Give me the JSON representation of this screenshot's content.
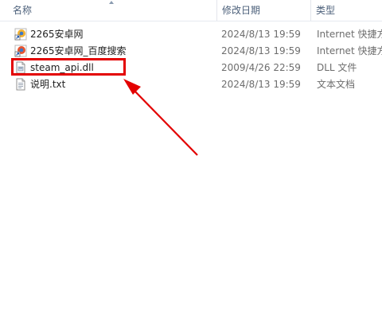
{
  "header": {
    "name_label": "名称",
    "date_label": "修改日期",
    "type_label": "类型"
  },
  "files": [
    {
      "name": "2265安卓网",
      "date": "2024/8/13 19:59",
      "type": "Internet 快捷方",
      "icon": "internet-shortcut-icon"
    },
    {
      "name": "2265安卓网_百度搜索",
      "date": "2024/8/13 19:59",
      "type": "Internet 快捷方",
      "icon": "internet-shortcut-icon"
    },
    {
      "name": "steam_api.dll",
      "date": "2009/4/26 22:59",
      "type": "DLL 文件",
      "icon": "dll-file-icon"
    },
    {
      "name": "说明.txt",
      "date": "2024/8/13 19:59",
      "type": "文本文档",
      "icon": "text-file-icon"
    }
  ],
  "colors": {
    "highlight": "#e30000",
    "header_text": "#4c607a"
  }
}
